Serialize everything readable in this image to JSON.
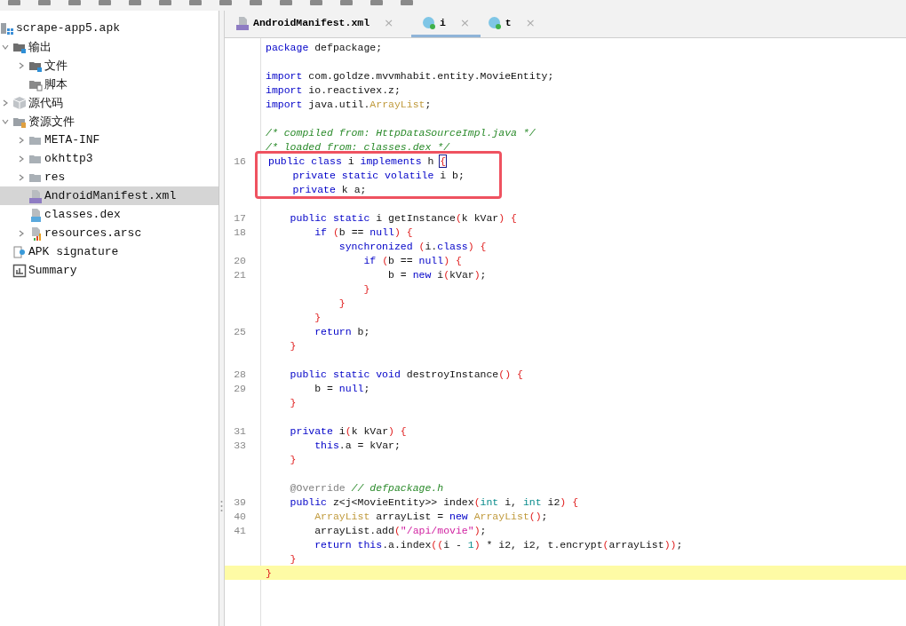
{
  "tree": [
    {
      "label": "scrape-app5.apk",
      "kind": "apk",
      "selected": false,
      "children": [
        {
          "label": "输出",
          "kind": "output",
          "selected": false,
          "expanded": true,
          "children": [
            {
              "label": "文件",
              "kind": "files",
              "selected": false,
              "expanded": false
            },
            {
              "label": "脚本",
              "kind": "script",
              "selected": false
            }
          ]
        },
        {
          "label": "源代码",
          "kind": "package",
          "selected": false,
          "expanded": false
        },
        {
          "label": "资源文件",
          "kind": "resources",
          "selected": false,
          "expanded": true,
          "children": [
            {
              "label": "META-INF",
              "kind": "folder",
              "selected": false,
              "expanded": false
            },
            {
              "label": "okhttp3",
              "kind": "folder",
              "selected": false,
              "expanded": false
            },
            {
              "label": "res",
              "kind": "folder",
              "selected": false,
              "expanded": false
            },
            {
              "label": "AndroidManifest.xml",
              "kind": "manifest",
              "selected": true
            },
            {
              "label": "classes.dex",
              "kind": "dex",
              "selected": false
            },
            {
              "label": "resources.arsc",
              "kind": "arsc",
              "selected": false,
              "expanded": false
            }
          ]
        },
        {
          "label": "APK signature",
          "kind": "signature",
          "selected": false
        },
        {
          "label": "Summary",
          "kind": "summary",
          "selected": false
        }
      ]
    }
  ],
  "tabs": [
    {
      "label": "AndroidManifest.xml",
      "kind": "manifest",
      "selected": false,
      "close": "×"
    },
    {
      "label": "i",
      "kind": "class",
      "selected": true,
      "close": "×"
    },
    {
      "label": "t",
      "kind": "class",
      "selected": false,
      "close": "×"
    }
  ],
  "code": [
    {
      "tokens": [
        {
          "kind": "keyword",
          "text": "package"
        },
        {
          "kind": "plain",
          "text": " defpackage;"
        }
      ]
    },
    {
      "blank": true
    },
    {
      "tokens": [
        {
          "kind": "keyword",
          "text": "import"
        },
        {
          "kind": "plain",
          "text": " com.goldze.mvvmhabit.entity.MovieEntity;"
        }
      ]
    },
    {
      "tokens": [
        {
          "kind": "keyword",
          "text": "import"
        },
        {
          "kind": "plain",
          "text": " io.reactivex.z;"
        }
      ]
    },
    {
      "tokens": [
        {
          "kind": "keyword",
          "text": "import"
        },
        {
          "kind": "plain",
          "text": " java.util."
        },
        {
          "kind": "type",
          "text": "ArrayList"
        },
        {
          "kind": "plain",
          "text": ";"
        }
      ]
    },
    {
      "blank": true
    },
    {
      "tokens": [
        {
          "kind": "comment",
          "text": "/* compiled from: HttpDataSourceImpl.java */"
        }
      ]
    },
    {
      "tokens": [
        {
          "kind": "comment",
          "text": "/* loaded from: classes.dex */"
        }
      ]
    },
    {
      "num": "16",
      "boxed": true,
      "tokens": [
        {
          "kind": "keyword",
          "text": "public class"
        },
        {
          "kind": "plain",
          "text": " i "
        },
        {
          "kind": "keyword",
          "text": "implements"
        },
        {
          "kind": "plain",
          "text": " h "
        },
        {
          "kind": "match",
          "text": "{"
        }
      ]
    },
    {
      "boxed": true,
      "tokens": [
        {
          "kind": "keyword",
          "text": "    private static volatile"
        },
        {
          "kind": "plain",
          "text": " i b;"
        }
      ]
    },
    {
      "boxed": true,
      "tokens": [
        {
          "kind": "keyword",
          "text": "    private"
        },
        {
          "kind": "plain",
          "text": " k a;"
        }
      ]
    },
    {
      "blank": true
    },
    {
      "num": "17",
      "tokens": [
        {
          "kind": "keyword",
          "text": "    public static"
        },
        {
          "kind": "plain",
          "text": " i getInstance"
        },
        {
          "kind": "bracket",
          "text": "("
        },
        {
          "kind": "plain",
          "text": "k kVar"
        },
        {
          "kind": "bracket",
          "text": ") {"
        }
      ]
    },
    {
      "num": "18",
      "tokens": [
        {
          "kind": "keyword",
          "text": "        if"
        },
        {
          "kind": "bracket",
          "text": " ("
        },
        {
          "kind": "plain",
          "text": "b == "
        },
        {
          "kind": "keyword",
          "text": "null"
        },
        {
          "kind": "bracket",
          "text": ") {"
        }
      ]
    },
    {
      "tokens": [
        {
          "kind": "keyword",
          "text": "            synchronized"
        },
        {
          "kind": "bracket",
          "text": " ("
        },
        {
          "kind": "plain",
          "text": "i."
        },
        {
          "kind": "keyword",
          "text": "class"
        },
        {
          "kind": "bracket",
          "text": ") {"
        }
      ]
    },
    {
      "num": "20",
      "tokens": [
        {
          "kind": "keyword",
          "text": "                if"
        },
        {
          "kind": "bracket",
          "text": " ("
        },
        {
          "kind": "plain",
          "text": "b == "
        },
        {
          "kind": "keyword",
          "text": "null"
        },
        {
          "kind": "bracket",
          "text": ") {"
        }
      ]
    },
    {
      "num": "21",
      "tokens": [
        {
          "kind": "plain",
          "text": "                    b = "
        },
        {
          "kind": "keyword",
          "text": "new"
        },
        {
          "kind": "plain",
          "text": " i"
        },
        {
          "kind": "bracket",
          "text": "("
        },
        {
          "kind": "plain",
          "text": "kVar"
        },
        {
          "kind": "bracket",
          "text": ")"
        },
        {
          "kind": "plain",
          "text": ";"
        }
      ]
    },
    {
      "tokens": [
        {
          "kind": "bracket",
          "text": "                }"
        }
      ]
    },
    {
      "tokens": [
        {
          "kind": "bracket",
          "text": "            }"
        }
      ]
    },
    {
      "tokens": [
        {
          "kind": "bracket",
          "text": "        }"
        }
      ]
    },
    {
      "num": "25",
      "tokens": [
        {
          "kind": "keyword",
          "text": "        return"
        },
        {
          "kind": "plain",
          "text": " b;"
        }
      ]
    },
    {
      "tokens": [
        {
          "kind": "bracket",
          "text": "    }"
        }
      ]
    },
    {
      "blank": true
    },
    {
      "num": "28",
      "tokens": [
        {
          "kind": "keyword",
          "text": "    public static void"
        },
        {
          "kind": "plain",
          "text": " destroyInstance"
        },
        {
          "kind": "bracket",
          "text": "() {"
        }
      ]
    },
    {
      "num": "29",
      "tokens": [
        {
          "kind": "plain",
          "text": "        b = "
        },
        {
          "kind": "keyword",
          "text": "null"
        },
        {
          "kind": "plain",
          "text": ";"
        }
      ]
    },
    {
      "tokens": [
        {
          "kind": "bracket",
          "text": "    }"
        }
      ]
    },
    {
      "blank": true
    },
    {
      "num": "31",
      "tokens": [
        {
          "kind": "keyword",
          "text": "    private"
        },
        {
          "kind": "plain",
          "text": " i"
        },
        {
          "kind": "bracket",
          "text": "("
        },
        {
          "kind": "plain",
          "text": "k kVar"
        },
        {
          "kind": "bracket",
          "text": ") {"
        }
      ]
    },
    {
      "num": "33",
      "tokens": [
        {
          "kind": "keyword",
          "text": "        this"
        },
        {
          "kind": "plain",
          "text": ".a = kVar;"
        }
      ]
    },
    {
      "tokens": [
        {
          "kind": "bracket",
          "text": "    }"
        }
      ]
    },
    {
      "blank": true
    },
    {
      "tokens": [
        {
          "kind": "annotation",
          "text": "    @Override"
        },
        {
          "kind": "comment",
          "text": " // defpackage.h"
        }
      ]
    },
    {
      "num": "39",
      "tokens": [
        {
          "kind": "keyword",
          "text": "    public"
        },
        {
          "kind": "plain",
          "text": " z<j<MovieEntity>> index"
        },
        {
          "kind": "bracket",
          "text": "("
        },
        {
          "kind": "primitive",
          "text": "int"
        },
        {
          "kind": "plain",
          "text": " i, "
        },
        {
          "kind": "primitive",
          "text": "int"
        },
        {
          "kind": "plain",
          "text": " i2"
        },
        {
          "kind": "bracket",
          "text": ") {"
        }
      ]
    },
    {
      "num": "40",
      "tokens": [
        {
          "kind": "type",
          "text": "        ArrayList"
        },
        {
          "kind": "plain",
          "text": " arrayList = "
        },
        {
          "kind": "keyword",
          "text": "new"
        },
        {
          "kind": "type",
          "text": " ArrayList"
        },
        {
          "kind": "bracket",
          "text": "()"
        },
        {
          "kind": "plain",
          "text": ";"
        }
      ]
    },
    {
      "num": "41",
      "tokens": [
        {
          "kind": "plain",
          "text": "        arrayList.add"
        },
        {
          "kind": "bracket",
          "text": "("
        },
        {
          "kind": "string",
          "text": "\"/api/movie\""
        },
        {
          "kind": "bracket",
          "text": ")"
        },
        {
          "kind": "plain",
          "text": ";"
        }
      ]
    },
    {
      "tokens": [
        {
          "kind": "keyword",
          "text": "        return this"
        },
        {
          "kind": "plain",
          "text": ".a.index"
        },
        {
          "kind": "bracket",
          "text": "(("
        },
        {
          "kind": "plain",
          "text": "i - "
        },
        {
          "kind": "number",
          "text": "1"
        },
        {
          "kind": "bracket",
          "text": ")"
        },
        {
          "kind": "plain",
          "text": " * i2, i2, t.encrypt"
        },
        {
          "kind": "bracket",
          "text": "("
        },
        {
          "kind": "plain",
          "text": "arrayList"
        },
        {
          "kind": "bracket",
          "text": "))"
        },
        {
          "kind": "plain",
          "text": ";"
        }
      ]
    },
    {
      "tokens": [
        {
          "kind": "bracket",
          "text": "    }"
        }
      ]
    },
    {
      "current": true,
      "tokens": [
        {
          "kind": "bracket",
          "text": "}"
        }
      ]
    }
  ]
}
